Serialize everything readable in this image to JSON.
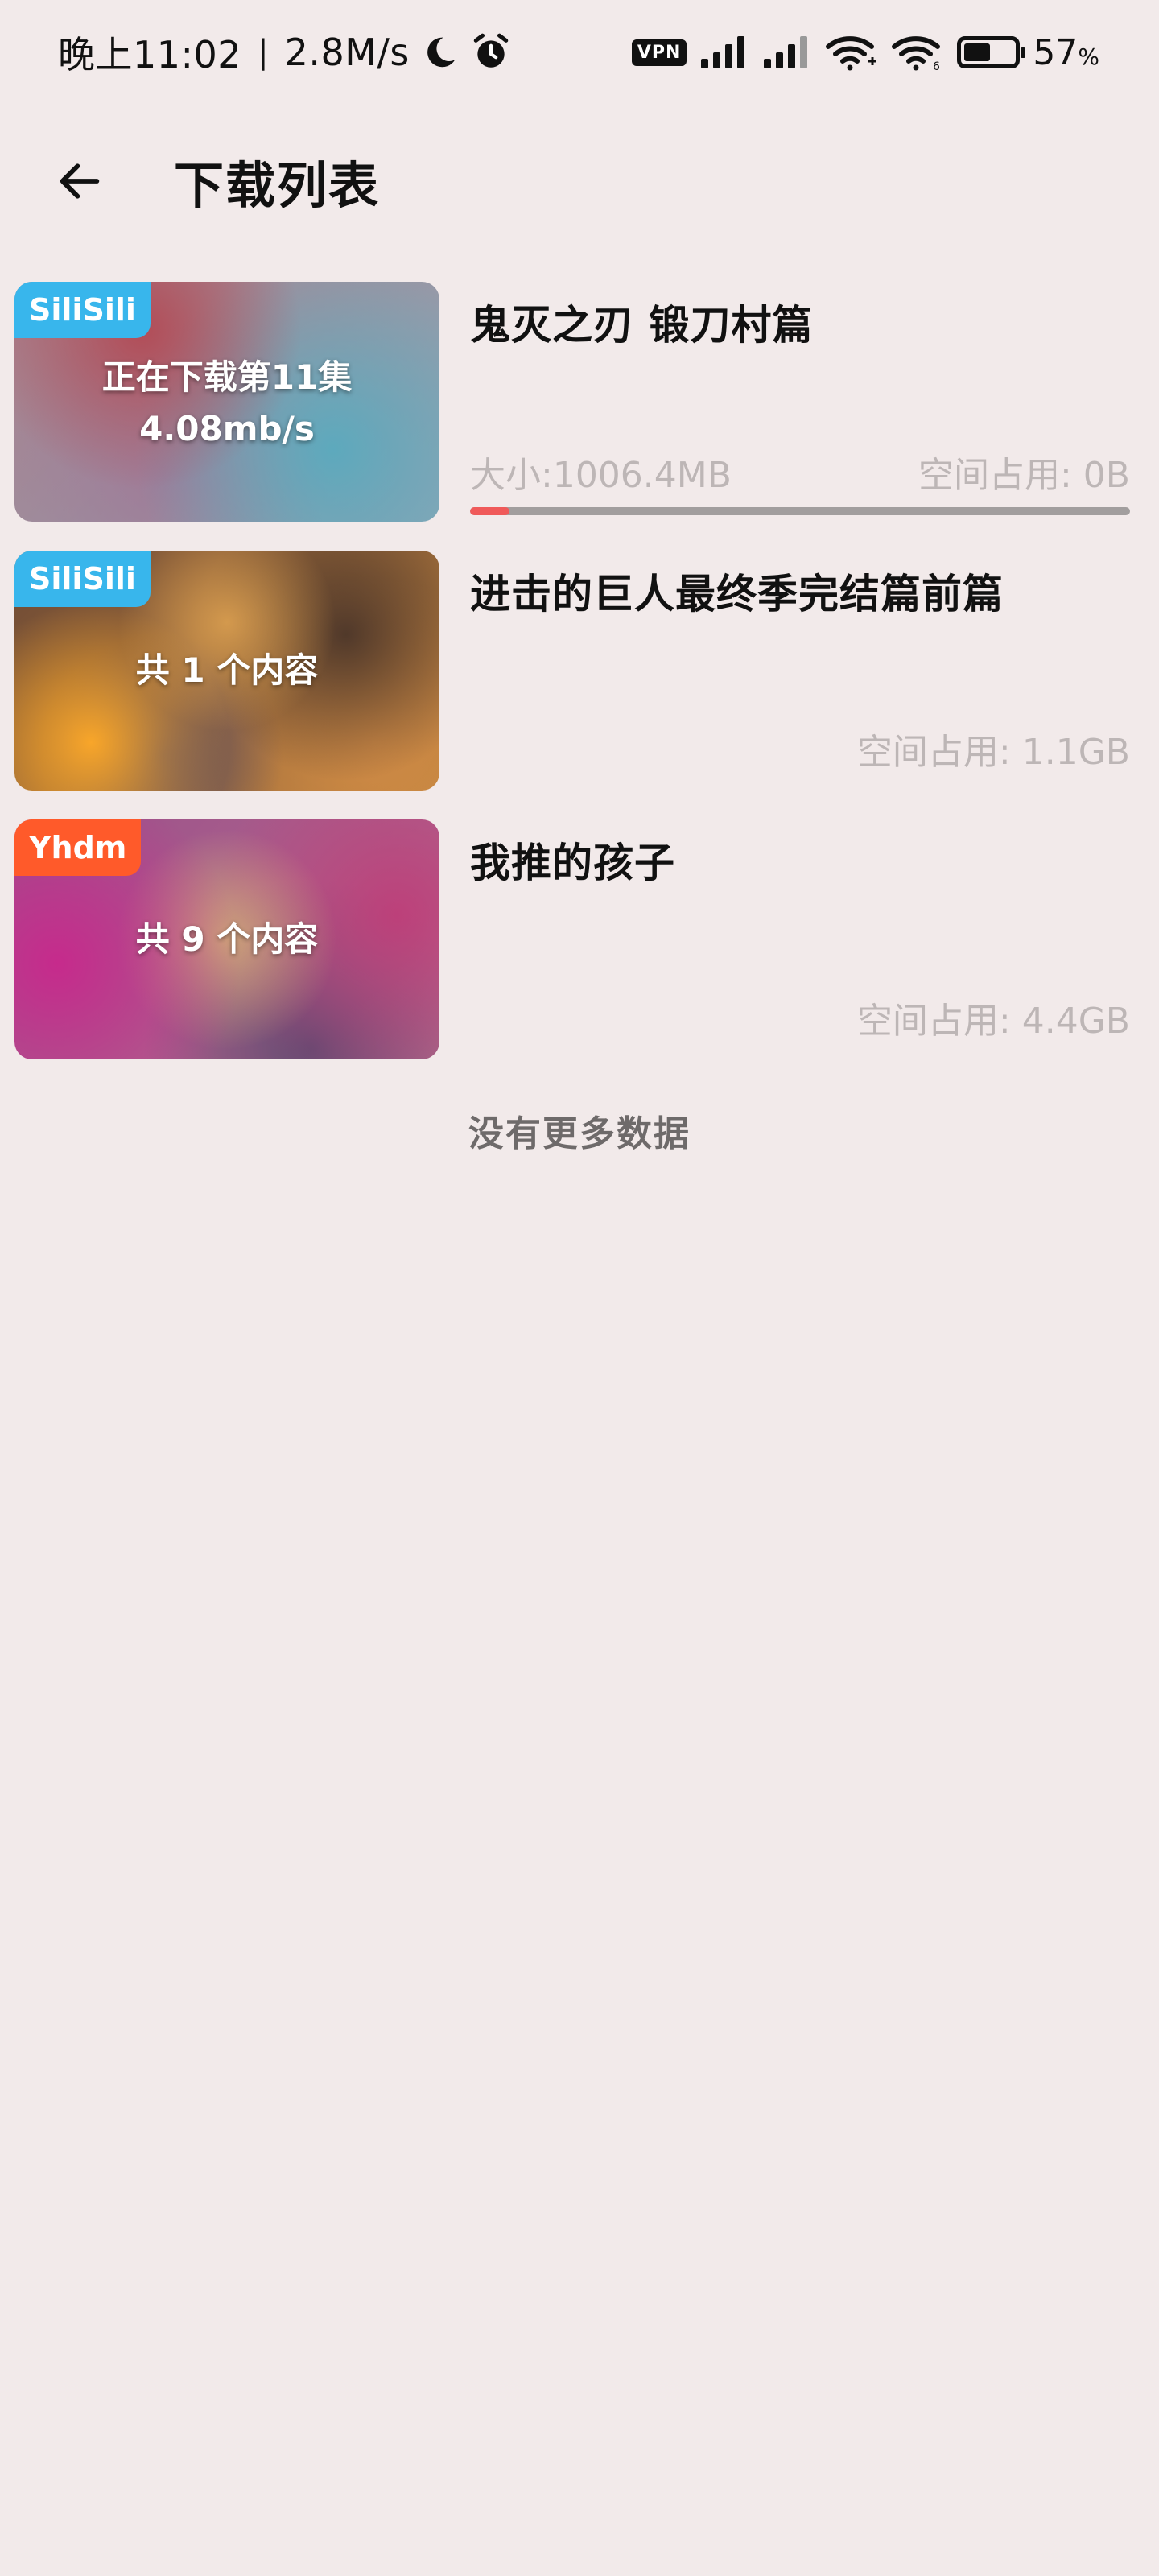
{
  "status_bar": {
    "time": "晚上11:02",
    "separator": "|",
    "net_speed": "2.8M/s",
    "vpn": "VPN",
    "battery_percent": "57",
    "battery_unit": "%"
  },
  "header": {
    "title": "下载列表"
  },
  "items": [
    {
      "source": "SiliSili",
      "caption_line1": "正在下载第11集",
      "caption_line2": "4.08mb/s",
      "title": "鬼灭之刃 锻刀村篇",
      "size": "大小:1006.4MB",
      "space": "空间占用: 0B",
      "progress": 0.06
    },
    {
      "source": "SiliSili",
      "caption_line1": "共 1 个内容",
      "title": "进击的巨人最终季完结篇前篇",
      "space": "空间占用: 1.1GB"
    },
    {
      "source": "Yhdm",
      "caption_line1": "共 9 个内容",
      "title": "我推的孩子",
      "space": "空间占用: 4.4GB"
    }
  ],
  "footer": {
    "end_text": "没有更多数据"
  },
  "colors": {
    "background": "#f2eaea",
    "badge_blue": "#38b6ec",
    "badge_orange": "#ff5a2a",
    "progress_fill": "#f05a5a",
    "progress_track": "#a29e9e"
  }
}
